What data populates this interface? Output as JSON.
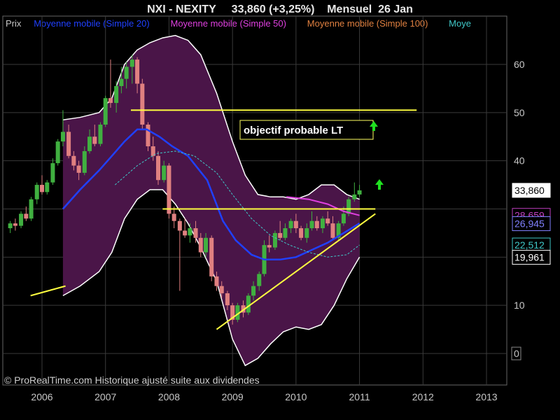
{
  "header": {
    "title": "NXI - NEXITY     33,860 (+3,25%)    Mensuel  26 Jan"
  },
  "legend": [
    {
      "label": "Prix",
      "color": "#c8c8c8"
    },
    {
      "label": "Moyenne mobile (Simple 20)",
      "color": "#2040ff"
    },
    {
      "label": "Moyenne mobile (Simple 50)",
      "color": "#e040e0"
    },
    {
      "label": "Moyenne mobile (Simple 100)",
      "color": "#e08040"
    },
    {
      "label": "Moye",
      "color": "#40c8c8"
    }
  ],
  "credit": "© ProRealTime.com Historique ajusté suite aux dividendes",
  "annotation": {
    "text": "objectif probable LT",
    "arrow_icon": "up-arrow-icon"
  },
  "value_tags": [
    {
      "text": "33,860",
      "value": 33.86,
      "bg": "#ffffff",
      "fg": "#000000",
      "border": "#ffffff"
    },
    {
      "text": "28,659",
      "value": 28.659,
      "bg": "#000000",
      "fg": "#c040c0",
      "border": "#c040c0"
    },
    {
      "text": "26,945",
      "value": 26.945,
      "bg": "#000000",
      "fg": "#8080ff",
      "border": "#8080ff"
    },
    {
      "text": "22,512",
      "value": 22.512,
      "bg": "#000000",
      "fg": "#40c8c8",
      "border": "#40c8c8"
    },
    {
      "text": "19,961",
      "value": 19.961,
      "bg": "#000000",
      "fg": "#ffffff",
      "border": "#ffffff"
    }
  ],
  "colors": {
    "background": "#000000",
    "grid": "#3a3a3a",
    "band_fill": "#4a1548",
    "band_edge": "#ffffff",
    "candle_up": "#40b040",
    "candle_down": "#e08080",
    "sma20": "#2040ff",
    "sma50": "#e040e0",
    "sma100": "#40c8c8",
    "trendline": "#ffff40",
    "arrow": "#20e020"
  },
  "chart_data": {
    "type": "candlestick",
    "ylim": [
      -7,
      67
    ],
    "y_ticks": [
      0,
      10,
      20,
      30,
      40,
      50,
      60
    ],
    "y_tick_labels": [
      "0",
      "10",
      "",
      "",
      "40",
      "50",
      "60"
    ],
    "xlim": [
      2005.45,
      2013.35
    ],
    "x_ticks": [
      2006,
      2007,
      2008,
      2009,
      2010,
      2011,
      2012,
      2013
    ],
    "x_tick_labels": [
      "2006",
      "2007",
      "2008",
      "2009",
      "2010",
      "2011",
      "2012",
      "2013"
    ],
    "grid": true,
    "candles": [
      {
        "t": 2005.5,
        "o": 26.0,
        "h": 27.5,
        "l": 25.0,
        "c": 27.0
      },
      {
        "t": 2005.58,
        "o": 27.0,
        "h": 28.0,
        "l": 25.5,
        "c": 26.5
      },
      {
        "t": 2005.67,
        "o": 26.5,
        "h": 29.5,
        "l": 26.0,
        "c": 29.0
      },
      {
        "t": 2005.75,
        "o": 29.0,
        "h": 30.5,
        "l": 27.5,
        "c": 28.0
      },
      {
        "t": 2005.83,
        "o": 28.0,
        "h": 32.5,
        "l": 27.5,
        "c": 32.0
      },
      {
        "t": 2005.92,
        "o": 32.0,
        "h": 35.5,
        "l": 31.0,
        "c": 35.0
      },
      {
        "t": 2006.0,
        "o": 35.0,
        "h": 37.0,
        "l": 33.0,
        "c": 33.5
      },
      {
        "t": 2006.08,
        "o": 33.5,
        "h": 36.0,
        "l": 33.0,
        "c": 35.5
      },
      {
        "t": 2006.17,
        "o": 35.5,
        "h": 40.5,
        "l": 35.0,
        "c": 39.5
      },
      {
        "t": 2006.25,
        "o": 39.5,
        "h": 44.5,
        "l": 39.0,
        "c": 44.0
      },
      {
        "t": 2006.33,
        "o": 44.0,
        "h": 50.5,
        "l": 43.0,
        "c": 46.0
      },
      {
        "t": 2006.42,
        "o": 46.0,
        "h": 47.5,
        "l": 40.5,
        "c": 41.0
      },
      {
        "t": 2006.5,
        "o": 41.0,
        "h": 42.0,
        "l": 38.0,
        "c": 39.0
      },
      {
        "t": 2006.58,
        "o": 39.0,
        "h": 40.0,
        "l": 36.0,
        "c": 37.5
      },
      {
        "t": 2006.67,
        "o": 37.5,
        "h": 43.0,
        "l": 37.0,
        "c": 42.0
      },
      {
        "t": 2006.75,
        "o": 42.0,
        "h": 46.5,
        "l": 41.5,
        "c": 45.0
      },
      {
        "t": 2006.83,
        "o": 45.0,
        "h": 47.5,
        "l": 43.0,
        "c": 43.5
      },
      {
        "t": 2006.92,
        "o": 43.5,
        "h": 48.0,
        "l": 43.0,
        "c": 47.5
      },
      {
        "t": 2007.0,
        "o": 47.5,
        "h": 53.5,
        "l": 47.0,
        "c": 53.0
      },
      {
        "t": 2007.08,
        "o": 53.0,
        "h": 61.0,
        "l": 51.0,
        "c": 52.0
      },
      {
        "t": 2007.17,
        "o": 52.0,
        "h": 56.5,
        "l": 50.0,
        "c": 55.5
      },
      {
        "t": 2007.25,
        "o": 55.5,
        "h": 59.5,
        "l": 54.0,
        "c": 57.0
      },
      {
        "t": 2007.33,
        "o": 57.0,
        "h": 60.5,
        "l": 55.0,
        "c": 59.5
      },
      {
        "t": 2007.42,
        "o": 59.5,
        "h": 62.0,
        "l": 56.0,
        "c": 61.0
      },
      {
        "t": 2007.5,
        "o": 61.0,
        "h": 61.5,
        "l": 54.0,
        "c": 56.0
      },
      {
        "t": 2007.58,
        "o": 56.0,
        "h": 57.0,
        "l": 46.5,
        "c": 47.5
      },
      {
        "t": 2007.67,
        "o": 47.5,
        "h": 48.0,
        "l": 42.0,
        "c": 43.0
      },
      {
        "t": 2007.75,
        "o": 43.0,
        "h": 45.0,
        "l": 40.0,
        "c": 41.0
      },
      {
        "t": 2007.83,
        "o": 41.0,
        "h": 42.0,
        "l": 35.0,
        "c": 36.0
      },
      {
        "t": 2007.92,
        "o": 36.0,
        "h": 40.0,
        "l": 35.5,
        "c": 39.0
      },
      {
        "t": 2008.0,
        "o": 39.0,
        "h": 39.5,
        "l": 28.0,
        "c": 29.0
      },
      {
        "t": 2008.08,
        "o": 29.0,
        "h": 30.5,
        "l": 26.0,
        "c": 27.5
      },
      {
        "t": 2008.17,
        "o": 27.5,
        "h": 28.0,
        "l": 13.0,
        "c": 25.5
      },
      {
        "t": 2008.25,
        "o": 25.5,
        "h": 28.0,
        "l": 24.0,
        "c": 24.5
      },
      {
        "t": 2008.33,
        "o": 24.5,
        "h": 27.0,
        "l": 23.0,
        "c": 26.0
      },
      {
        "t": 2008.42,
        "o": 26.0,
        "h": 27.5,
        "l": 23.0,
        "c": 24.0
      },
      {
        "t": 2008.5,
        "o": 24.0,
        "h": 25.0,
        "l": 20.0,
        "c": 21.0
      },
      {
        "t": 2008.58,
        "o": 21.0,
        "h": 25.0,
        "l": 20.0,
        "c": 24.0
      },
      {
        "t": 2008.67,
        "o": 24.0,
        "h": 24.5,
        "l": 15.0,
        "c": 16.0
      },
      {
        "t": 2008.75,
        "o": 16.0,
        "h": 17.0,
        "l": 13.0,
        "c": 14.0
      },
      {
        "t": 2008.83,
        "o": 14.0,
        "h": 15.0,
        "l": 11.5,
        "c": 12.5
      },
      {
        "t": 2008.92,
        "o": 12.5,
        "h": 13.0,
        "l": 9.0,
        "c": 10.0
      },
      {
        "t": 2009.0,
        "o": 10.0,
        "h": 10.5,
        "l": 6.0,
        "c": 7.0
      },
      {
        "t": 2009.08,
        "o": 7.0,
        "h": 10.5,
        "l": 6.5,
        "c": 10.0
      },
      {
        "t": 2009.17,
        "o": 10.0,
        "h": 11.0,
        "l": 7.5,
        "c": 8.5
      },
      {
        "t": 2009.25,
        "o": 8.5,
        "h": 12.5,
        "l": 8.0,
        "c": 12.0
      },
      {
        "t": 2009.33,
        "o": 12.0,
        "h": 15.0,
        "l": 11.0,
        "c": 14.0
      },
      {
        "t": 2009.42,
        "o": 14.0,
        "h": 17.0,
        "l": 13.0,
        "c": 16.5
      },
      {
        "t": 2009.5,
        "o": 16.5,
        "h": 23.5,
        "l": 16.0,
        "c": 22.5
      },
      {
        "t": 2009.58,
        "o": 22.5,
        "h": 24.5,
        "l": 21.0,
        "c": 22.0
      },
      {
        "t": 2009.67,
        "o": 22.0,
        "h": 25.5,
        "l": 21.5,
        "c": 25.0
      },
      {
        "t": 2009.75,
        "o": 25.0,
        "h": 27.5,
        "l": 23.5,
        "c": 24.0
      },
      {
        "t": 2009.83,
        "o": 24.0,
        "h": 27.0,
        "l": 23.5,
        "c": 26.0
      },
      {
        "t": 2009.92,
        "o": 26.0,
        "h": 28.0,
        "l": 25.0,
        "c": 27.5
      },
      {
        "t": 2010.0,
        "o": 27.5,
        "h": 29.0,
        "l": 25.0,
        "c": 26.0
      },
      {
        "t": 2010.08,
        "o": 26.0,
        "h": 26.5,
        "l": 23.5,
        "c": 24.0
      },
      {
        "t": 2010.17,
        "o": 24.0,
        "h": 27.0,
        "l": 23.0,
        "c": 26.0
      },
      {
        "t": 2010.25,
        "o": 26.0,
        "h": 29.5,
        "l": 25.5,
        "c": 27.5
      },
      {
        "t": 2010.33,
        "o": 27.5,
        "h": 28.5,
        "l": 25.5,
        "c": 26.0
      },
      {
        "t": 2010.42,
        "o": 26.0,
        "h": 28.5,
        "l": 25.0,
        "c": 28.0
      },
      {
        "t": 2010.5,
        "o": 28.0,
        "h": 29.5,
        "l": 26.5,
        "c": 27.0
      },
      {
        "t": 2010.58,
        "o": 27.0,
        "h": 28.5,
        "l": 23.5,
        "c": 24.0
      },
      {
        "t": 2010.67,
        "o": 24.0,
        "h": 27.5,
        "l": 23.5,
        "c": 27.0
      },
      {
        "t": 2010.75,
        "o": 27.0,
        "h": 30.5,
        "l": 26.5,
        "c": 29.0
      },
      {
        "t": 2010.83,
        "o": 29.0,
        "h": 32.5,
        "l": 28.5,
        "c": 32.0
      },
      {
        "t": 2010.92,
        "o": 32.0,
        "h": 35.5,
        "l": 31.5,
        "c": 33.0
      },
      {
        "t": 2011.0,
        "o": 33.0,
        "h": 35.0,
        "l": 32.5,
        "c": 33.86
      }
    ],
    "series": [
      {
        "name": "Moyenne mobile (Simple 20)",
        "x": [
          2006.33,
          2006.6,
          2006.9,
          2007.1,
          2007.3,
          2007.5,
          2007.65,
          2007.85,
          2008.05,
          2008.3,
          2008.6,
          2008.85,
          2009.05,
          2009.3,
          2009.5,
          2009.75,
          2010.0,
          2010.25,
          2010.5,
          2010.75,
          2011.0
        ],
        "y": [
          30.0,
          34.0,
          38.0,
          41.0,
          44.0,
          46.5,
          46.5,
          45.0,
          43.0,
          41.0,
          36.0,
          27.5,
          23.5,
          20.5,
          19.5,
          19.5,
          20.0,
          21.5,
          23.0,
          25.0,
          27.0
        ]
      },
      {
        "name": "Moyenne mobile (Simple 50)",
        "x": [
          2009.85,
          2010.2,
          2010.5,
          2010.75,
          2011.0
        ],
        "y": [
          32.5,
          32.0,
          31.0,
          29.5,
          28.659
        ]
      },
      {
        "name": "Moyenne mobile (Simple 100)",
        "x": [
          2007.15,
          2007.5,
          2007.8,
          2008.1,
          2008.4,
          2008.75,
          2009.0,
          2009.3,
          2009.6,
          2009.9,
          2010.2,
          2010.5,
          2010.8,
          2011.0
        ],
        "y": [
          35.0,
          39.0,
          41.5,
          42.0,
          41.0,
          37.5,
          33.0,
          28.0,
          24.5,
          22.5,
          21.0,
          20.0,
          20.5,
          22.512
        ]
      }
    ],
    "bands": {
      "x": [
        2006.33,
        2006.6,
        2006.9,
        2007.1,
        2007.3,
        2007.5,
        2007.7,
        2007.9,
        2008.1,
        2008.3,
        2008.5,
        2008.75,
        2009.0,
        2009.2,
        2009.4,
        2009.6,
        2009.8,
        2010.0,
        2010.2,
        2010.4,
        2010.6,
        2010.8,
        2011.0
      ],
      "upper": [
        48.5,
        49.0,
        50.0,
        53.0,
        60.0,
        63.0,
        64.5,
        65.5,
        66.0,
        65.0,
        62.0,
        54.0,
        44.0,
        37.0,
        33.0,
        32.5,
        32.5,
        32.0,
        33.0,
        35.0,
        35.0,
        33.0,
        32.0
      ],
      "lower": [
        12.0,
        14.0,
        17.0,
        21.0,
        28.0,
        32.0,
        34.0,
        34.0,
        31.0,
        27.0,
        22.0,
        15.0,
        3.0,
        -2.5,
        -1.0,
        2.0,
        4.5,
        5.5,
        5.0,
        6.0,
        10.0,
        15.5,
        20.0
      ]
    },
    "annotations": [
      {
        "kind": "hline",
        "y": 50.5,
        "x1": 2007.4,
        "x2": 2011.9
      },
      {
        "kind": "hline",
        "y": 30.0,
        "x1": 2007.9,
        "x2": 2011.25
      },
      {
        "kind": "segment",
        "x1": 2008.75,
        "y1": 5.0,
        "x2": 2011.25,
        "y2": 29.0
      },
      {
        "kind": "segment",
        "x1": 2005.82,
        "y1": 12.0,
        "x2": 2006.37,
        "y2": 14.0
      }
    ]
  }
}
